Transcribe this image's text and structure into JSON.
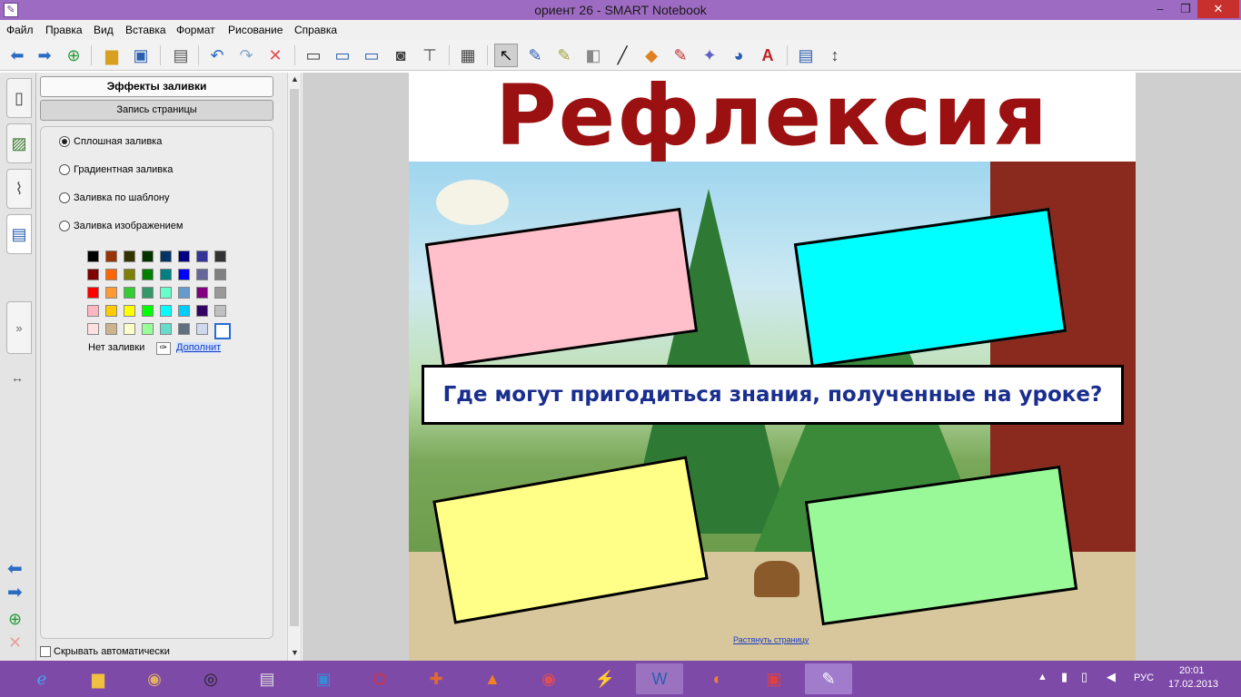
{
  "window": {
    "title": "ориент 26 - SMART Notebook",
    "app_icon": "notebook-icon",
    "minimize": "‒",
    "maximize": "❐",
    "close": "✕"
  },
  "menu": [
    "Файл",
    "Правка",
    "Вид",
    "Вставка",
    "Формат",
    "Рисование",
    "Справка"
  ],
  "panel": {
    "header": "Эффекты заливки",
    "record_button": "Запись страницы",
    "fill_options": [
      {
        "label": "Сплошная заливка",
        "selected": true
      },
      {
        "label": "Градиентная заливка",
        "selected": false
      },
      {
        "label": "Заливка по шаблону",
        "selected": false
      },
      {
        "label": "Заливка изображением",
        "selected": false
      }
    ],
    "swatches": [
      [
        "#000000",
        "#993300",
        "#333300",
        "#003300",
        "#003366",
        "#000080",
        "#333399",
        "#333333"
      ],
      [
        "#800000",
        "#ff6600",
        "#808000",
        "#008000",
        "#008080",
        "#0000ff",
        "#666699",
        "#808080"
      ],
      [
        "#ff0000",
        "#ff9933",
        "#33cc33",
        "#339966",
        "#66ffcc",
        "#6699cc",
        "#800080",
        "#999999"
      ],
      [
        "#ffb6c1",
        "#ffcc00",
        "#ffff00",
        "#00ff00",
        "#00ffff",
        "#00ccff",
        "#330066",
        "#c0c0c0"
      ],
      [
        "#ffe0e0",
        "#ccb38c",
        "#ffffcc",
        "#99ff99",
        "#66ddcc",
        "#607080",
        "#d0d8ee",
        "#ffffff"
      ]
    ],
    "no_fill": "Нет заливки",
    "more": "Дополнит",
    "auto_hide": "Скрывать автоматически"
  },
  "slide": {
    "title": "Рефлексия",
    "question": "Где могут пригодиться знания, полученные на уроке?",
    "card_colors": [
      "#ffc0cb",
      "#00ffff",
      "#ffff88",
      "#99f999"
    ],
    "stretch_link": "Растянуть страницу"
  },
  "tray": {
    "lang": "РУС",
    "time": "20:01",
    "date": "17.02.2013"
  }
}
